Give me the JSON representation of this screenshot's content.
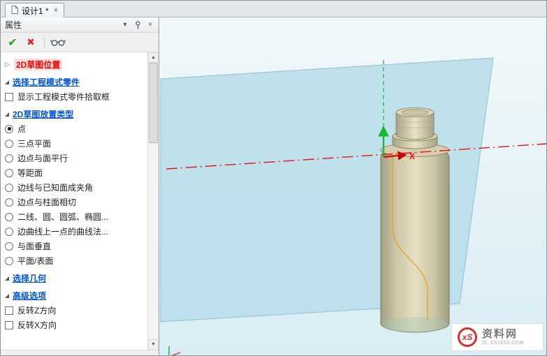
{
  "tabbar": {
    "tabs": [
      {
        "label": "设计1 *",
        "close": "×"
      }
    ]
  },
  "panel": {
    "title": "属性",
    "titlebar": {
      "menu_icon": "▾",
      "close_icon": "×"
    },
    "toolbar": {
      "ok": "✔",
      "cancel": "✖"
    },
    "items": [
      {
        "type": "collapsed-header",
        "label": "2D草图位置"
      },
      {
        "type": "header",
        "label": "选择工程模式零件"
      },
      {
        "type": "checkbox",
        "label": "显示工程模式零件拾取框",
        "checked": false
      },
      {
        "type": "header",
        "label": "2D草图放置类型"
      },
      {
        "type": "radio",
        "label": "点",
        "checked": true
      },
      {
        "type": "radio",
        "label": "三点平面",
        "checked": false
      },
      {
        "type": "radio",
        "label": "边点与面平行",
        "checked": false
      },
      {
        "type": "radio",
        "label": "等距面",
        "checked": false
      },
      {
        "type": "radio",
        "label": "边线与已知面成夹角",
        "checked": false
      },
      {
        "type": "radio",
        "label": "边点与柱面相切",
        "checked": false
      },
      {
        "type": "radio",
        "label": "二线、圆、圆弧、椭圆...",
        "checked": false
      },
      {
        "type": "radio",
        "label": "边曲线上一点的曲线法...",
        "checked": false
      },
      {
        "type": "radio",
        "label": "与面垂直",
        "checked": false
      },
      {
        "type": "radio",
        "label": "平面/表面",
        "checked": false
      },
      {
        "type": "header",
        "label": "选择几何"
      },
      {
        "type": "header",
        "label": "高级选项"
      },
      {
        "type": "checkbox",
        "label": "反转Z方向",
        "checked": false
      },
      {
        "type": "checkbox",
        "label": "反转X方向",
        "checked": false
      }
    ],
    "scrollbar": {
      "up": "▲",
      "down": "▼"
    }
  },
  "viewport": {
    "axis_x_label": "X",
    "colors": {
      "axis_x": "#e81010",
      "axis_y": "#11bb33",
      "plane": "#b7ddea",
      "bottle": "#d6cfae"
    }
  },
  "watermark": {
    "logo": "xS",
    "name": "资料网",
    "url": "ZL.XS1616.COM"
  }
}
